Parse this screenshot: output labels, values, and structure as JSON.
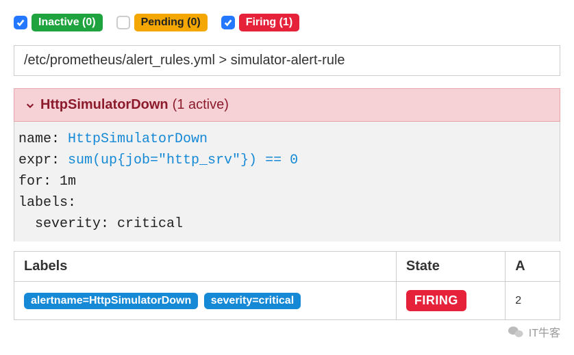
{
  "filters": {
    "inactive": {
      "label": "Inactive (0)",
      "checked": true
    },
    "pending": {
      "label": "Pending (0)",
      "checked": false
    },
    "firing": {
      "label": "Firing (1)",
      "checked": true
    }
  },
  "breadcrumb": "/etc/prometheus/alert_rules.yml > simulator-alert-rule",
  "alert": {
    "name": "HttpSimulatorDown",
    "active_text": "(1 active)"
  },
  "rule": {
    "name_label": "name: ",
    "name_value": "HttpSimulatorDown",
    "expr_label": "expr: ",
    "expr_value": "sum(up{job=\"http_srv\"}) == 0",
    "for_line": "for: 1m",
    "labels_line": "labels:",
    "severity_line": "  severity: critical"
  },
  "table": {
    "headers": {
      "labels": "Labels",
      "state": "State",
      "last": "A"
    },
    "row": {
      "label_alertname": "alertname=HttpSimulatorDown",
      "label_severity": "severity=critical",
      "state": "FIRING",
      "last": "2"
    }
  },
  "watermark": "IT牛客"
}
